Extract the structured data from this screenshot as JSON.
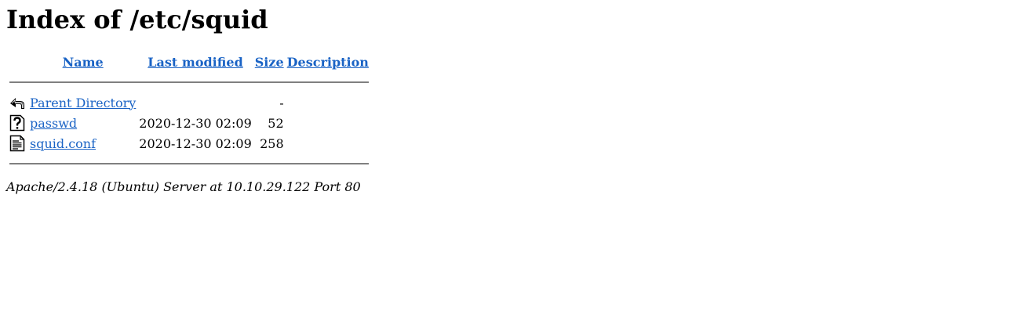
{
  "page": {
    "title": "Index of /etc/squid"
  },
  "columns": {
    "name": "Name",
    "last_modified": "Last modified",
    "size": "Size",
    "description": "Description"
  },
  "rows": [
    {
      "icon": "back-arrow-icon",
      "name": "Parent Directory",
      "modified": "",
      "size": "-",
      "description": ""
    },
    {
      "icon": "unknown-file-icon",
      "name": "passwd",
      "modified": "2020-12-30 02:09",
      "size": "52",
      "description": ""
    },
    {
      "icon": "text-file-icon",
      "name": "squid.conf",
      "modified": "2020-12-30 02:09",
      "size": "258",
      "description": ""
    }
  ],
  "footer": {
    "address": "Apache/2.4.18 (Ubuntu) Server at 10.10.29.122 Port 80"
  },
  "colors": {
    "link": "#1a63c5",
    "separator": "#808080"
  }
}
